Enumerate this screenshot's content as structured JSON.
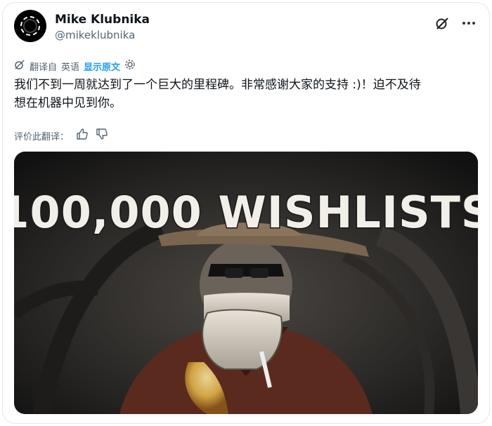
{
  "header": {
    "name": "Mike Klubnika",
    "handle": "@mikeklubnika"
  },
  "translation": {
    "translated_from_prefix": "翻译自",
    "language": "英语",
    "show_original": "显示原文"
  },
  "tweet": {
    "line1": "我们不到一周就达到了一个巨大的里程碑。非常感谢大家的支持 :)！迫不及待",
    "line2": "想在机器中见到你。"
  },
  "rate": {
    "label": "评价此翻译："
  },
  "media": {
    "banner": "100,000 WISHLISTS"
  },
  "colors": {
    "link": "#1d9bf0",
    "muted": "#536471",
    "text": "#0f1419"
  },
  "icons": [
    "grok-icon",
    "more-icon",
    "translate-icon",
    "gear-icon",
    "thumbs-up-icon",
    "thumbs-down-icon"
  ]
}
